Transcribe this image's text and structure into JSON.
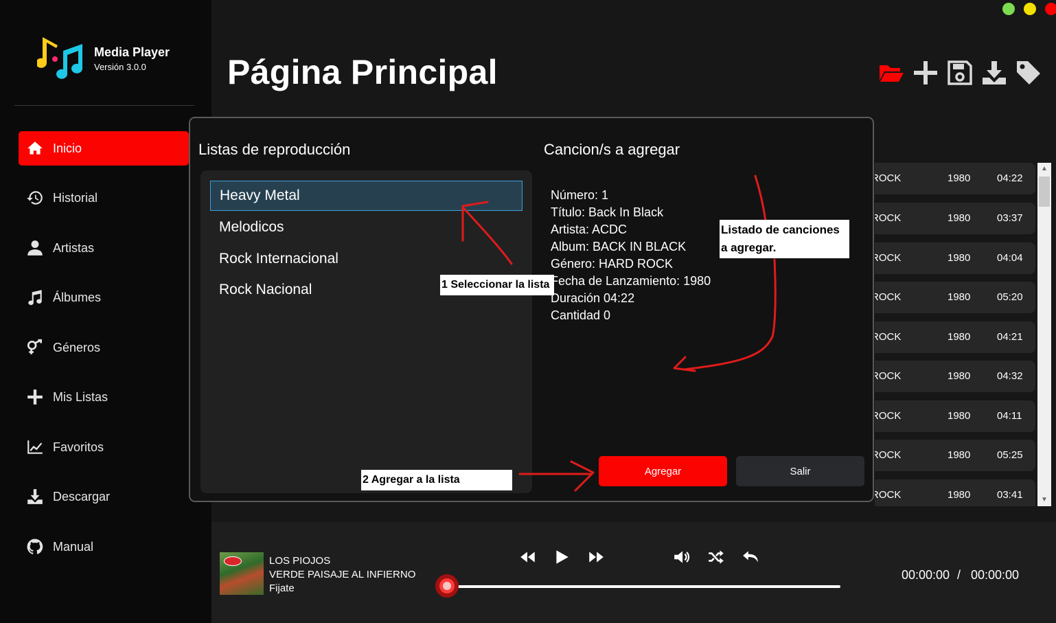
{
  "app": {
    "name": "Media Player",
    "version": "Versión 3.0.0"
  },
  "window_controls": [
    {
      "name": "minimize",
      "color": "#7cdc52"
    },
    {
      "name": "maximize",
      "color": "#f3e000"
    },
    {
      "name": "close",
      "color": "#ff0000"
    }
  ],
  "sidebar": {
    "items": [
      {
        "label": "Inicio",
        "icon": "home-icon",
        "active": true
      },
      {
        "label": "Historial",
        "icon": "history-icon"
      },
      {
        "label": "Artistas",
        "icon": "user-icon"
      },
      {
        "label": "Álbumes",
        "icon": "music-note-icon"
      },
      {
        "label": "Géneros",
        "icon": "genders-icon"
      },
      {
        "label": "Mis Listas",
        "icon": "plus-icon"
      },
      {
        "label": "Favoritos",
        "icon": "chart-line-icon"
      },
      {
        "label": "Descargar",
        "icon": "download-icon"
      },
      {
        "label": "Manual",
        "icon": "github-icon"
      }
    ]
  },
  "header": {
    "title": "Página Principal"
  },
  "toolbar": {
    "icons": [
      "folder-open-icon",
      "add-icon",
      "save-icon",
      "download-icon",
      "tag-icon"
    ],
    "accent": "#fb0300"
  },
  "songs_table": {
    "rows": [
      {
        "genre": "ROCK",
        "year": "1980",
        "duration": "04:22"
      },
      {
        "genre": "ROCK",
        "year": "1980",
        "duration": "03:37"
      },
      {
        "genre": "ROCK",
        "year": "1980",
        "duration": "04:04"
      },
      {
        "genre": "ROCK",
        "year": "1980",
        "duration": "05:20"
      },
      {
        "genre": "ROCK",
        "year": "1980",
        "duration": "04:21"
      },
      {
        "genre": "ROCK",
        "year": "1980",
        "duration": "04:32"
      },
      {
        "genre": "ROCK",
        "year": "1980",
        "duration": "04:11"
      },
      {
        "genre": "ROCK",
        "year": "1980",
        "duration": "05:25"
      },
      {
        "genre": "ROCK",
        "year": "1980",
        "duration": "03:41"
      }
    ]
  },
  "dialog": {
    "playlists_title": "Listas de reproducción",
    "songs_title": "Cancion/s a agregar",
    "playlists": [
      {
        "name": "Heavy Metal",
        "selected": true
      },
      {
        "name": "Melodicos"
      },
      {
        "name": "Rock Internacional"
      },
      {
        "name": "Rock Nacional"
      }
    ],
    "song_details": [
      "Número: 1",
      "Título: Back In Black",
      "Artista: ACDC",
      "Album: BACK IN BLACK",
      "Género: HARD ROCK",
      "Fecha de Lanzamiento: 1980",
      "Duración 04:22",
      "Cantidad 0"
    ],
    "add_label": "Agregar",
    "exit_label": "Salir"
  },
  "annotations": {
    "step1": "1 Seleccionar la lista",
    "step2": "2 Agregar a la lista",
    "songs_note_line1": "Listado de canciones",
    "songs_note_line2": "a agregar.",
    "arrow_color": "#e01b1b"
  },
  "player": {
    "artist": "LOS PIOJOS",
    "album": "VERDE PAISAJE AL INFIERNO",
    "track": "Fijate",
    "controls": [
      "rewind-icon",
      "play-icon",
      "fast-forward-icon",
      "volume-icon",
      "shuffle-icon",
      "repeat-icon"
    ],
    "elapsed": "00:00:00",
    "separator": "/",
    "total": "00:00:00",
    "progress_fraction": 0
  }
}
